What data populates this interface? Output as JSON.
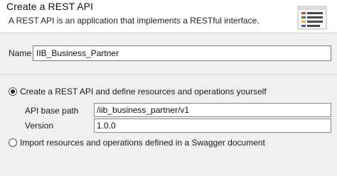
{
  "header": {
    "title": "Create a REST API",
    "description": "A REST API is an application that implements a RESTful interface.",
    "icon": "wizard-banner-icon"
  },
  "name_field": {
    "label": "Name",
    "value": "IIB_Business_Partner"
  },
  "options": {
    "define_yourself": {
      "label": "Create a REST API and define resources and operations yourself",
      "selected": true
    },
    "import_swagger": {
      "label": "Import resources and operations defined in a Swagger document",
      "selected": false
    }
  },
  "base_path": {
    "label": "API base path",
    "value": "/iib_business_partner/v1"
  },
  "version": {
    "label": "Version",
    "value": "1.0.0"
  }
}
